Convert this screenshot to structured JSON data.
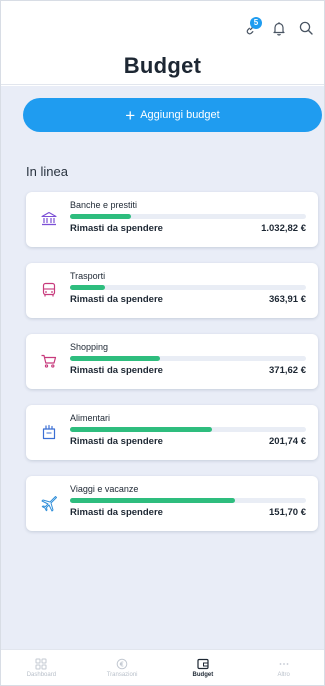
{
  "header": {
    "title": "Budget",
    "link_badge": "5",
    "icons": [
      "link-icon",
      "bell-icon",
      "search-icon"
    ]
  },
  "actions": {
    "add_budget_label": "Aggiungi budget",
    "add_icon": "plus-icon"
  },
  "section": {
    "label": "In linea"
  },
  "budgets": [
    {
      "name": "Banche e prestiti",
      "icon": "bank-icon",
      "icon_color": "#7b4fd6",
      "remaining_label": "Rimasti da spendere",
      "remaining": "1.032,82 €",
      "progress": 0.26
    },
    {
      "name": "Trasporti",
      "icon": "bus-icon",
      "icon_color": "#c73a7c",
      "remaining_label": "Rimasti da spendere",
      "remaining": "363,91 €",
      "progress": 0.15
    },
    {
      "name": "Shopping",
      "icon": "cart-icon",
      "icon_color": "#c73a7c",
      "remaining_label": "Rimasti da spendere",
      "remaining": "371,62 €",
      "progress": 0.38
    },
    {
      "name": "Alimentari",
      "icon": "grocery-bag-icon",
      "icon_color": "#3b6fd4",
      "remaining_label": "Rimasti da spendere",
      "remaining": "201,74 €",
      "progress": 0.6
    },
    {
      "name": "Viaggi e vacanze",
      "icon": "plane-icon",
      "icon_color": "#2f8ed9",
      "remaining_label": "Rimasti da spendere",
      "remaining": "151,70 €",
      "progress": 0.7
    }
  ],
  "nav": [
    {
      "label": "Dashboard",
      "icon": "dashboard-icon",
      "active": false
    },
    {
      "label": "Transazioni",
      "icon": "transactions-icon",
      "active": false
    },
    {
      "label": "Budget",
      "icon": "budget-icon",
      "active": true
    },
    {
      "label": "Altro",
      "icon": "more-icon",
      "active": false
    }
  ],
  "colors": {
    "accent": "#1f9cf0",
    "progress": "#2ebd7e",
    "badge": "#1f9cf0"
  }
}
